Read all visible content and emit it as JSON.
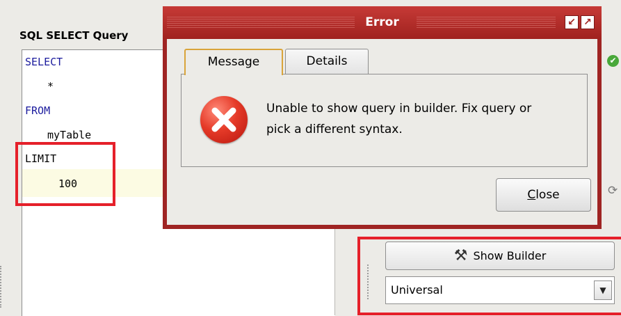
{
  "query_panel": {
    "label": "SQL SELECT Query",
    "code": [
      {
        "text": "SELECT",
        "keyword": true,
        "indent": 0
      },
      {
        "text": "*",
        "keyword": false,
        "indent": 1
      },
      {
        "text": "FROM",
        "keyword": true,
        "indent": 0
      },
      {
        "text": "myTable",
        "keyword": false,
        "indent": 1
      },
      {
        "text": "LIMIT",
        "keyword": false,
        "indent": 0
      },
      {
        "text": "100",
        "keyword": false,
        "indent": 1
      }
    ]
  },
  "builder": {
    "show_builder_label": "Show Builder",
    "syntax_value": "Universal"
  },
  "dialog": {
    "title": "Error",
    "tabs": [
      {
        "label": "Message",
        "active": true
      },
      {
        "label": "Details",
        "active": false
      }
    ],
    "message": "Unable to show query in builder. Fix query or pick a different syntax.",
    "close_mnemonic": "C",
    "close_rest": "lose"
  },
  "icons": {
    "status": "check-icon",
    "refresh": "refresh-icon",
    "error": "error-icon",
    "builder": "tools-icon"
  },
  "colors": {
    "dialog_title": "#a0221f",
    "annotation_box": "#e5202a",
    "keyword": "#1b1b9d"
  }
}
